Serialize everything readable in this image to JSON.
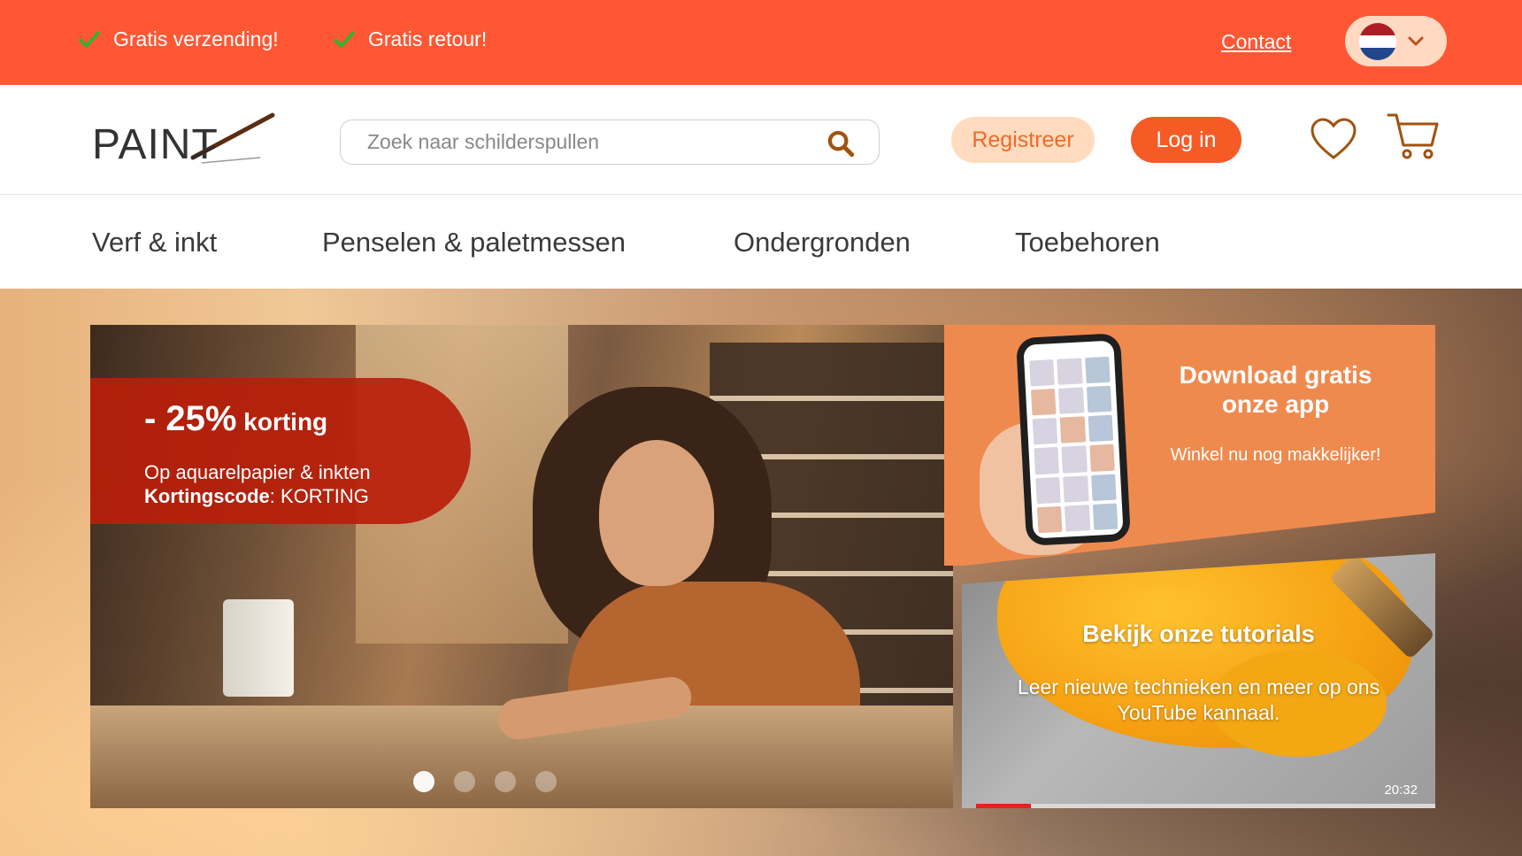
{
  "topbar": {
    "usps": [
      "Gratis verzending!",
      "Gratis retour!"
    ],
    "contact": "Contact",
    "language": {
      "flag_colors": [
        "#ae1c28",
        "#ffffff",
        "#21468b"
      ],
      "icon": "chevron-down-icon"
    }
  },
  "header": {
    "logo_text": "PAINT",
    "search": {
      "placeholder": "Zoek naar schilderspullen",
      "value": ""
    },
    "register": "Registreer",
    "login": "Log in",
    "icons": [
      "heart-icon",
      "cart-icon"
    ]
  },
  "nav": {
    "items": [
      "Verf & inkt",
      "Penselen & paletmessen",
      "Ondergronden",
      "Toebehoren"
    ]
  },
  "hero": {
    "promo": {
      "discount": "- 25%",
      "discount_word": "korting",
      "line1": "Op aquarelpapier & inkten",
      "code_label": "Kortingscode",
      "code_value": ": KORTING"
    },
    "carousel_dots": 4,
    "active_dot": 1,
    "app": {
      "title": "Download gratis onze app",
      "subtitle": "Winkel nu nog makkelijker!"
    },
    "video": {
      "title": "Bekijk onze tutorials",
      "subtitle": "Leer nieuwe technieken en meer op ons YouTube kannaal.",
      "duration": "20:32",
      "progress": 0.12
    }
  },
  "colors": {
    "topbar": "#ff5733",
    "accent": "#f65b25",
    "register_bg": "#ffdcbf",
    "check": "#2db52d"
  }
}
